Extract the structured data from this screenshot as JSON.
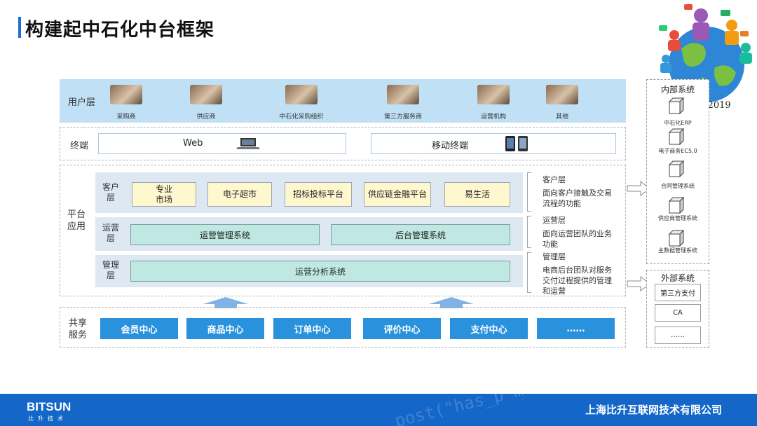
{
  "title": "构建起中石化中台框架",
  "logo": {
    "caption": "IAS 2019"
  },
  "user_layer": {
    "label": "用户层",
    "items": [
      "采购商",
      "供应商",
      "中石化采购组织",
      "第三方服务商",
      "运营机构",
      "其他"
    ]
  },
  "terminal": {
    "label": "终端",
    "web": "Web",
    "mobile": "移动终端"
  },
  "platform": {
    "label": "平台\n应用",
    "customer": {
      "label": "客户\n层",
      "boxes": [
        "专业\n市场",
        "电子超市",
        "招标投标平台",
        "供应链金融平台",
        "易生活"
      ],
      "note_title": "客户层",
      "note_text": "面向客户接触及交易流程的功能"
    },
    "operation": {
      "label": "运营\n层",
      "boxes": [
        "运营管理系统",
        "后台管理系统"
      ],
      "note_title": "运营层",
      "note_text": "面向运营团队的业务功能"
    },
    "management": {
      "label": "管理\n层",
      "boxes": [
        "运营分析系统"
      ],
      "note_title": "管理层",
      "note_text": "电商后台团队对服务交付过程提供的管理和运营"
    }
  },
  "shared": {
    "label": "共享\n服务",
    "boxes": [
      "会员中心",
      "商品中心",
      "订单中心",
      "评价中心",
      "支付中心",
      "……"
    ]
  },
  "internal": {
    "title": "内部系统",
    "items": [
      "中石化ERP",
      "电子商务EC5.0",
      "合同管理系统",
      "供应商管理系统",
      "主数据管理系统"
    ]
  },
  "external": {
    "title": "外部系统",
    "items": [
      "第三方支付",
      "CA",
      "……"
    ]
  },
  "footer": {
    "brand": "BITSUN",
    "brand_sub": "比升技术",
    "company": "上海比升互联网技术有限公司",
    "code_text": "post(\"has_p  m-6 co"
  },
  "colors": {
    "accent": "#1e6fd0",
    "user_layer_bg": "#bfe0f5",
    "shared_box": "#2a92dd",
    "yellow_box": "#fff8cf",
    "teal_box": "#bfe8e2",
    "footer_bg": "#1467c8"
  }
}
